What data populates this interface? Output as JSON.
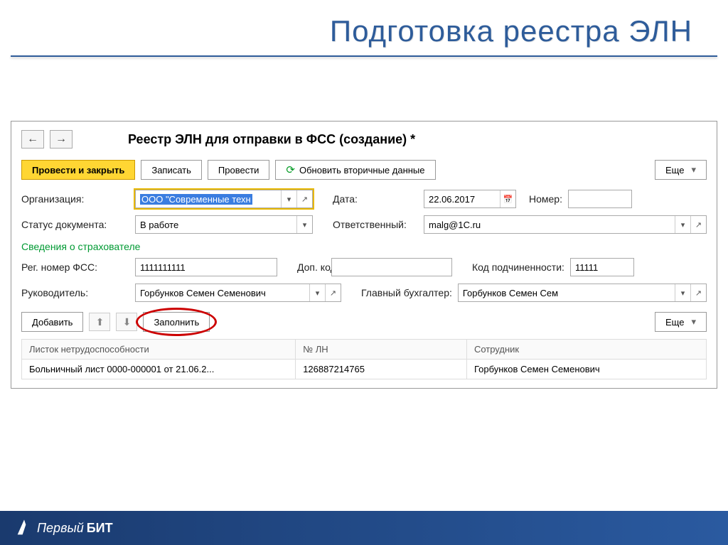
{
  "slide": {
    "title": "Подготовка реестра ЭЛН"
  },
  "window": {
    "title": "Реестр ЭЛН для отправки в ФСС (создание) *"
  },
  "toolbar": {
    "submit_close": "Провести и закрыть",
    "save": "Записать",
    "submit": "Провести",
    "refresh": "Обновить вторичные данные",
    "more": "Еще"
  },
  "fields": {
    "org_label": "Организация:",
    "org_value": "ООО \"Современные техн",
    "date_label": "Дата:",
    "date_value": "22.06.2017",
    "number_label": "Номер:",
    "number_value": "",
    "status_label": "Статус документа:",
    "status_value": "В работе",
    "responsible_label": "Ответственный:",
    "responsible_value": "malg@1C.ru",
    "section_insurer": "Сведения о страхователе",
    "reg_fss_label": "Рег. номер ФСС:",
    "reg_fss_value": "1111111111",
    "add_code_label": "Доп. код:",
    "add_code_value": "",
    "sub_code_label": "Код подчиненности:",
    "sub_code_value": "11111",
    "manager_label": "Руководитель:",
    "manager_value": "Горбунков Семен Семенович",
    "accountant_label": "Главный бухгалтер:",
    "accountant_value": "Горбунков Семен Сем"
  },
  "table_toolbar": {
    "add": "Добавить",
    "fill": "Заполнить",
    "more": "Еще"
  },
  "table": {
    "headers": {
      "sheet": "Листок нетрудоспособности",
      "number": "№ ЛН",
      "employee": "Сотрудник"
    },
    "rows": [
      {
        "sheet": "Больничный лист 0000-000001 от 21.06.2...",
        "number": "126887214765",
        "employee": "Горбунков Семен Семенович"
      }
    ]
  },
  "footer": {
    "brand1": "Первый",
    "brand2": "БИТ"
  }
}
